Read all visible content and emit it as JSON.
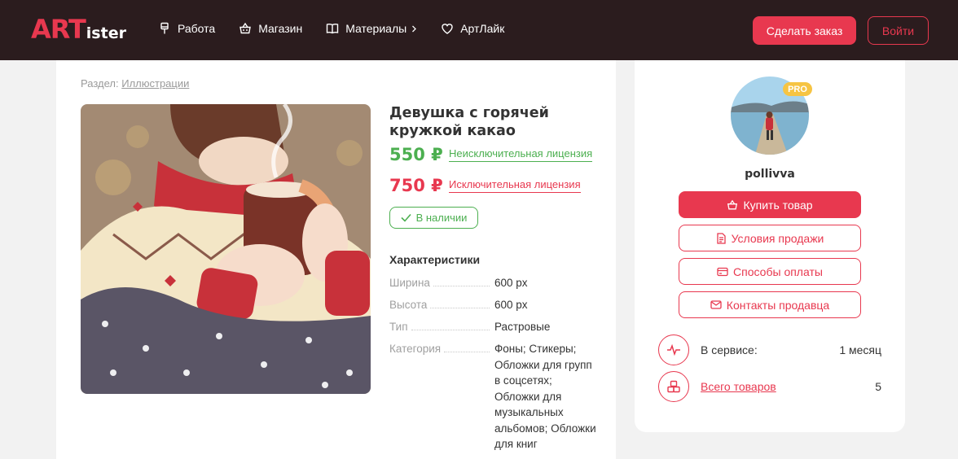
{
  "header": {
    "logo_art": "ART",
    "logo_ister": "ister",
    "nav": [
      {
        "label": "Работа",
        "icon": "brush-icon"
      },
      {
        "label": "Магазин",
        "icon": "basket-icon"
      },
      {
        "label": "Материалы",
        "icon": "book-icon",
        "has_submenu": true
      },
      {
        "label": "АртЛайк",
        "icon": "heart-icon"
      }
    ],
    "order_button": "Сделать заказ",
    "login_button": "Войти"
  },
  "product": {
    "section_label": "Раздел:",
    "section_link": "Иллюстрации",
    "artwork_icon": "artwork-image",
    "title": "Девушка с горячей кружкой какао",
    "price_nonexclusive": "550 ₽",
    "license_nonexclusive": "Неисключительная лицензия",
    "price_exclusive": "750 ₽",
    "license_exclusive": "Исключительная лицензия",
    "stock_label": "В наличии",
    "characteristics_title": "Характеристики",
    "characteristics": [
      {
        "key": "Ширина",
        "value": "600 px"
      },
      {
        "key": "Высота",
        "value": "600 px"
      },
      {
        "key": "Тип",
        "value": "Растровые"
      },
      {
        "key": "Категория",
        "value": "Фоны; Стикеры; Обложки для групп в соцсетях; Обложки для музыкальных альбомов; Обложки для книг"
      }
    ]
  },
  "seller": {
    "badge": "PRO",
    "username": "pollivva",
    "buttons": {
      "buy": "Купить товар",
      "terms": "Условия продажи",
      "payment": "Способы оплаты",
      "contacts": "Контакты продавца"
    },
    "stats": [
      {
        "label": "В сервисе:",
        "value": "1 месяц",
        "icon": "pulse-icon"
      },
      {
        "label": "Всего товаров",
        "value": "5",
        "icon": "boxes-icon"
      }
    ]
  },
  "colors": {
    "accent": "#e8384f",
    "header_bg": "#2b1c1e",
    "green": "#4caf50",
    "pro_badge": "#f6c443"
  }
}
